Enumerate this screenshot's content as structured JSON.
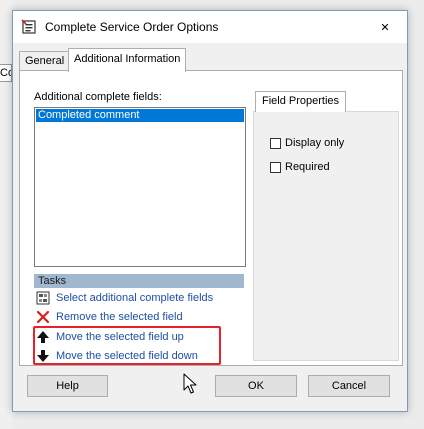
{
  "background": {
    "partial_label": "Co"
  },
  "window": {
    "title": "Complete Service Order Options",
    "close_glyph": "✕"
  },
  "tabs": [
    {
      "label": "General",
      "selected": false
    },
    {
      "label": "Additional Information",
      "selected": true
    }
  ],
  "fields": {
    "label": "Additional complete fields:",
    "items": [
      "Completed comment"
    ],
    "selected_index": 0
  },
  "tasks": {
    "header": "Tasks",
    "items": [
      {
        "label": "Select additional complete fields",
        "icon": "select-fields-icon"
      },
      {
        "label": "Remove the selected field",
        "icon": "red-x-icon"
      },
      {
        "label": "Move the selected field up",
        "icon": "arrow-up-icon"
      },
      {
        "label": "Move the selected field down",
        "icon": "arrow-down-icon"
      }
    ]
  },
  "field_properties": {
    "tab_label": "Field Properties",
    "checkboxes": [
      {
        "label": "Display only",
        "checked": false
      },
      {
        "label": "Required",
        "checked": false
      }
    ]
  },
  "buttons": {
    "help": "Help",
    "ok": "OK",
    "cancel": "Cancel"
  },
  "colors": {
    "selection": "#0078d7",
    "tasks_header": "#9fb7cf",
    "link": "#1e4fa3",
    "highlight_box": "#e8202a"
  }
}
